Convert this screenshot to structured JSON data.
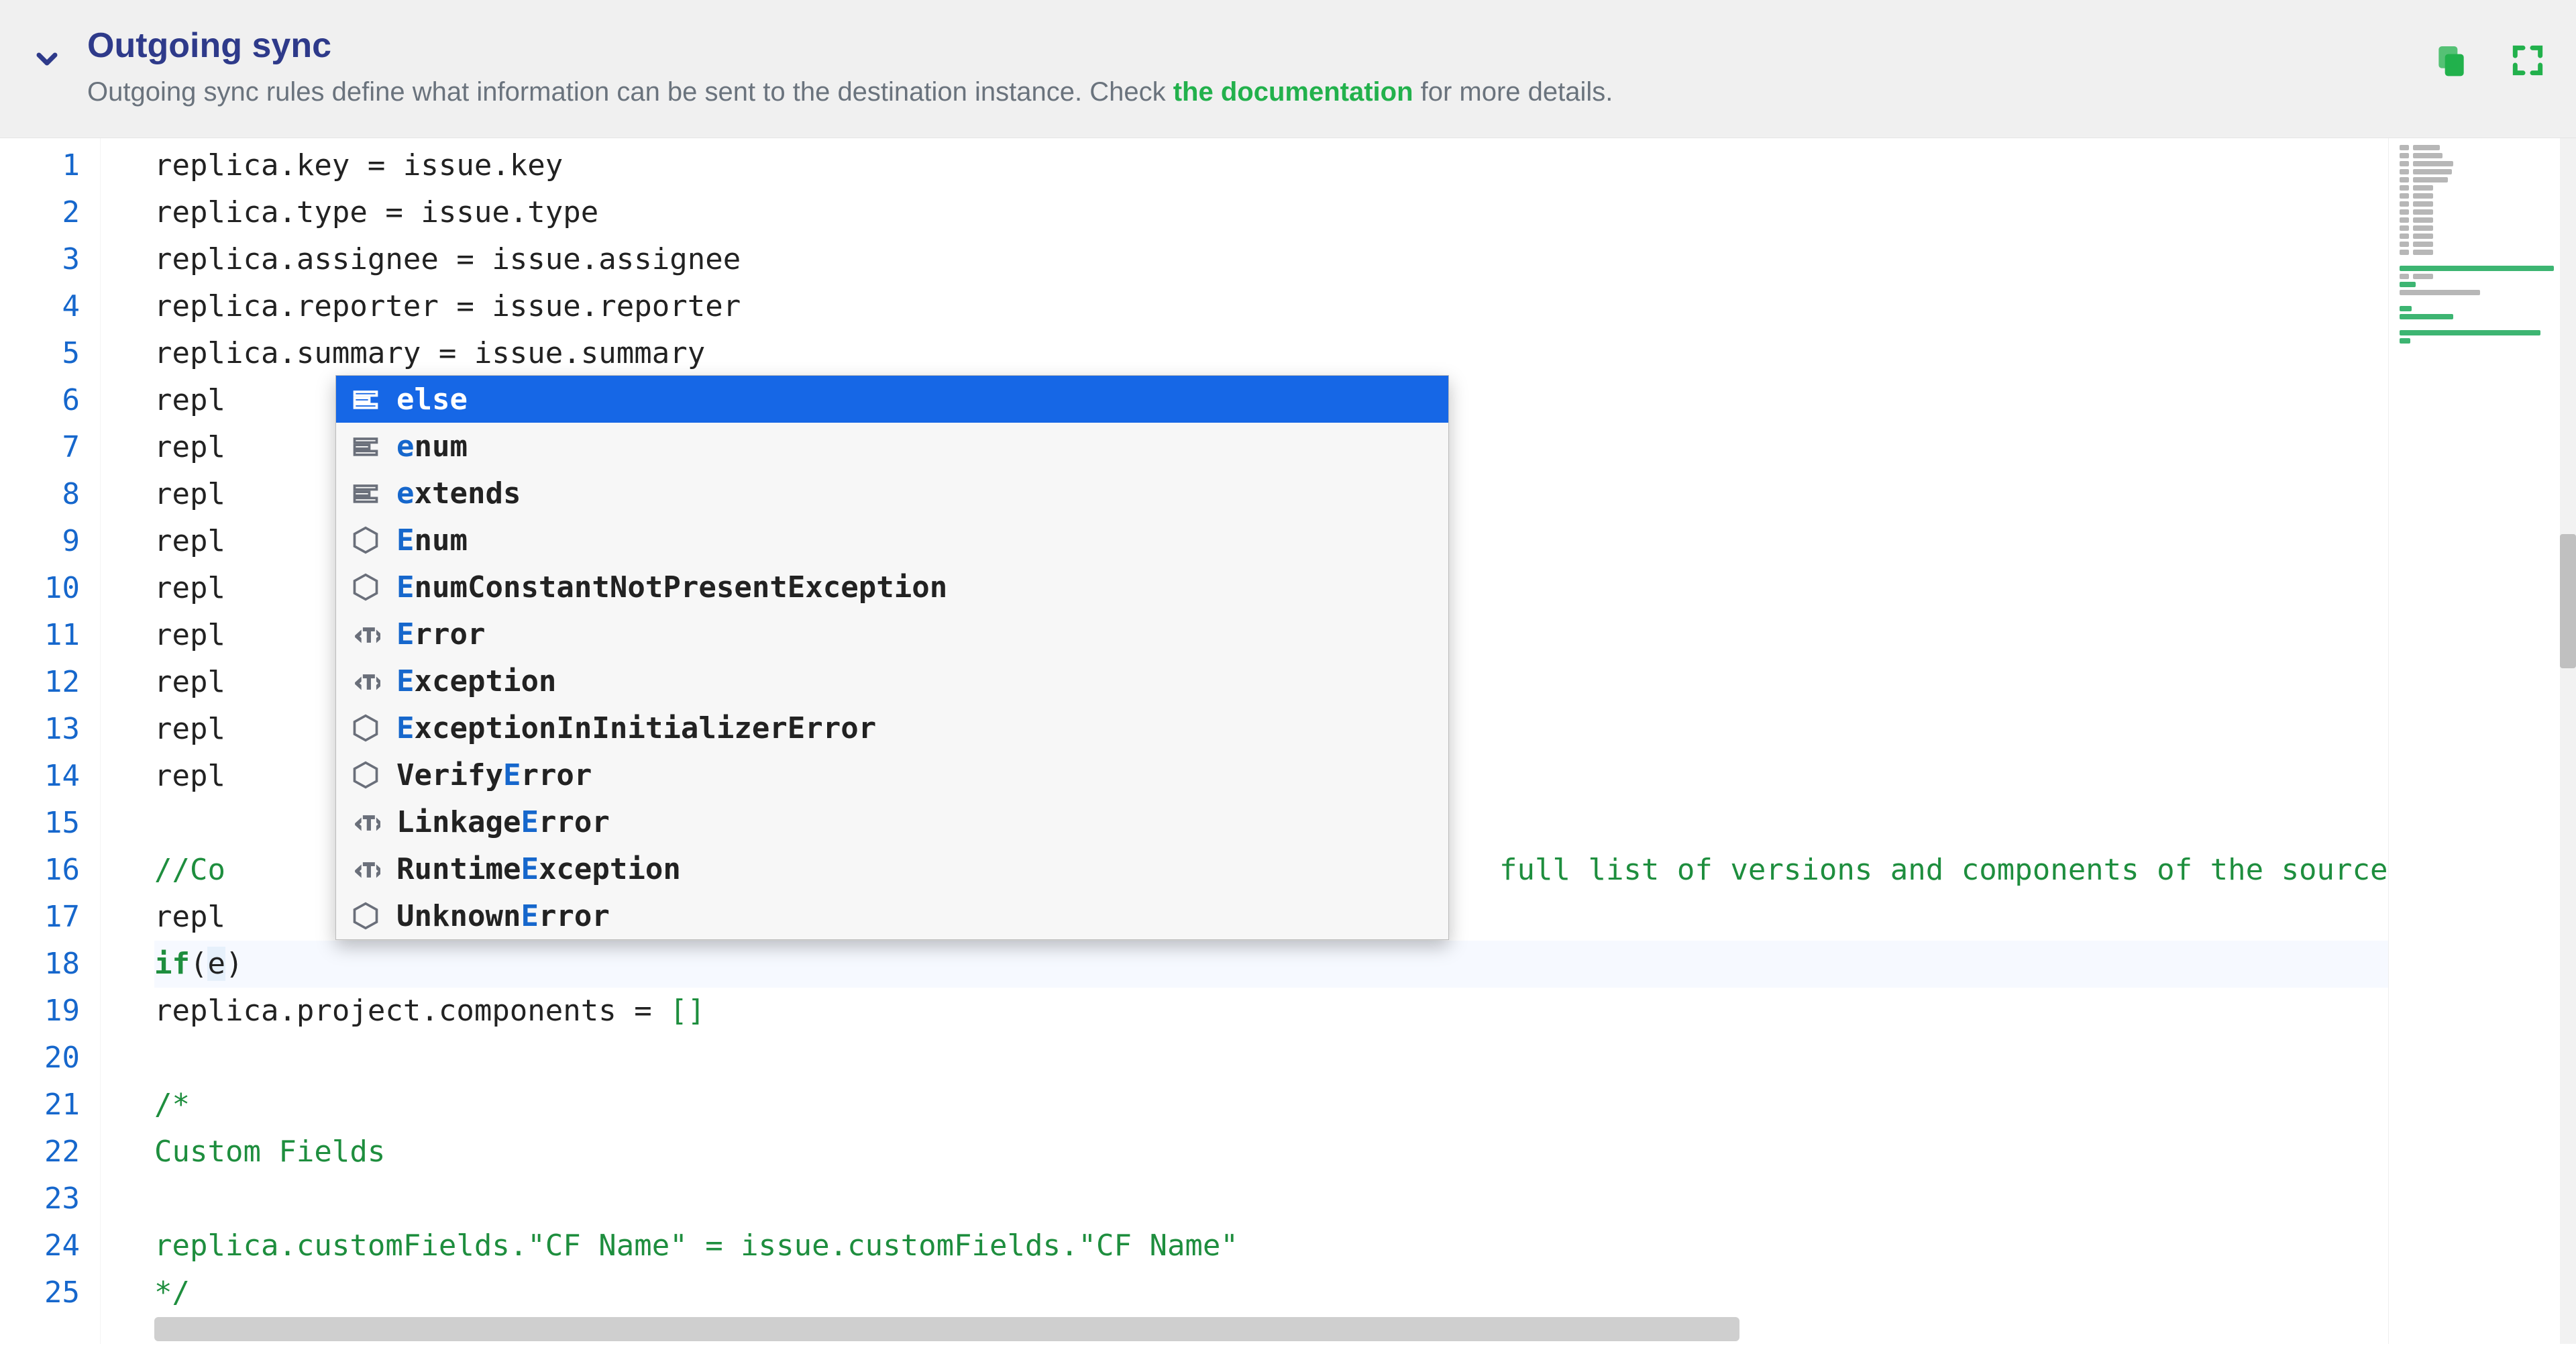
{
  "header": {
    "title": "Outgoing sync",
    "subtitle_prefix": "Outgoing sync rules define what information can be sent to the destination instance. Check ",
    "doc_link_label": "the documentation",
    "subtitle_suffix": " for more details."
  },
  "icons": {
    "collapse": "chevron-down-icon",
    "copy": "copy-icon",
    "fullscreen": "fullscreen-icon"
  },
  "gutter_start": 1,
  "gutter_end": 25,
  "code_lines": [
    {
      "type": "assign",
      "lhs": "replica.key",
      "rhs": "issue.key"
    },
    {
      "type": "assign",
      "lhs": "replica.type",
      "rhs": "issue.type"
    },
    {
      "type": "assign",
      "lhs": "replica.assignee",
      "rhs": "issue.assignee"
    },
    {
      "type": "assign",
      "lhs": "replica.reporter",
      "rhs": "issue.reporter"
    },
    {
      "type": "assign",
      "lhs": "replica.summary",
      "rhs": "issue.summary"
    },
    {
      "type": "partial",
      "text": "repl"
    },
    {
      "type": "partial",
      "text": "repl"
    },
    {
      "type": "partial",
      "text": "repl"
    },
    {
      "type": "partial",
      "text": "repl"
    },
    {
      "type": "partial",
      "text": "repl"
    },
    {
      "type": "partial",
      "text": "repl"
    },
    {
      "type": "partial",
      "text": "repl"
    },
    {
      "type": "partial",
      "text": "repl"
    },
    {
      "type": "partial",
      "text": "repl"
    },
    {
      "type": "blank"
    },
    {
      "type": "comment_partial",
      "prefix": "//Co",
      "suffix": "full list of versions and components of the source proje"
    },
    {
      "type": "partial",
      "text": "repl"
    },
    {
      "type": "ifexpr",
      "kw": "if",
      "open": "(",
      "arg": "e",
      "close": ")"
    },
    {
      "type": "plain",
      "text": "replica.project.components = ",
      "tail_bracket": "[]"
    },
    {
      "type": "blank"
    },
    {
      "type": "comment",
      "text": "/*"
    },
    {
      "type": "comment",
      "text": "Custom Fields"
    },
    {
      "type": "blank"
    },
    {
      "type": "comment",
      "text": "replica.customFields.\"CF Name\" = issue.customFields.\"CF Name\""
    },
    {
      "type": "comment",
      "text": "*/"
    }
  ],
  "current_line_index": 17,
  "autocomplete": {
    "items": [
      {
        "icon": "keyword",
        "label": "else",
        "selected": true
      },
      {
        "icon": "keyword",
        "label": "enum"
      },
      {
        "icon": "keyword",
        "label": "extends"
      },
      {
        "icon": "class",
        "label": "Enum"
      },
      {
        "icon": "class",
        "label": "EnumConstantNotPresentException"
      },
      {
        "icon": "type",
        "label": "Error"
      },
      {
        "icon": "type",
        "label": "Exception"
      },
      {
        "icon": "class",
        "label": "ExceptionInInitializerError"
      },
      {
        "icon": "class",
        "label": "VerifyError"
      },
      {
        "icon": "type",
        "label": "LinkageError"
      },
      {
        "icon": "type",
        "label": "RuntimeException"
      },
      {
        "icon": "class",
        "label": "UnknownError"
      }
    ]
  },
  "colors": {
    "accent_green": "#22b14c",
    "title_blue": "#2e3a8a",
    "selection_blue": "#1667e6",
    "line_number_blue": "#1667cc"
  }
}
